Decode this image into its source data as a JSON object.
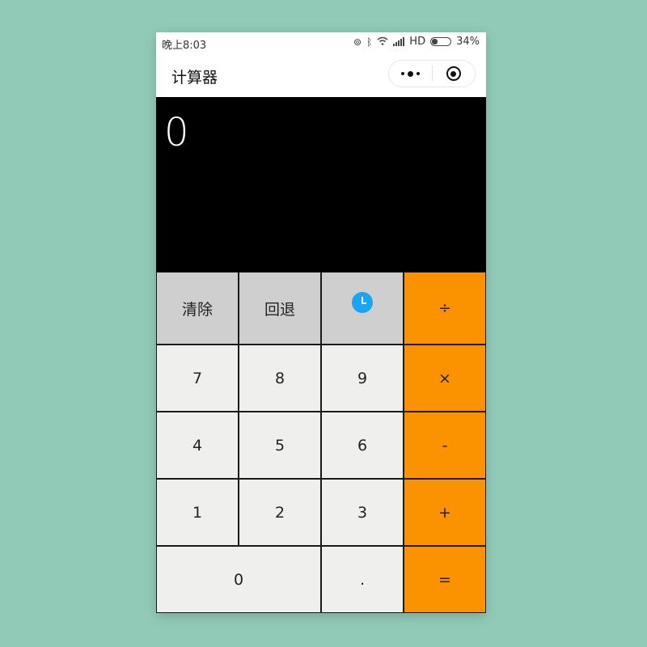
{
  "status_bar": {
    "time": "晚上8:03",
    "network": "HD",
    "battery": "34%",
    "icons": [
      "link-icon",
      "bluetooth-icon",
      "wifi-icon",
      "signal-icon",
      "battery-icon"
    ]
  },
  "nav": {
    "title": "计算器",
    "more_icon": "more-dots-icon",
    "close_icon": "target-circle-icon"
  },
  "display": {
    "value": "0"
  },
  "keys": {
    "clear": "清除",
    "backspace": "回退",
    "history_icon": "history-clock-icon",
    "divide": "÷",
    "multiply": "×",
    "minus": "-",
    "plus": "+",
    "equals": "=",
    "dot": ".",
    "digits": [
      "0",
      "1",
      "2",
      "3",
      "4",
      "5",
      "6",
      "7",
      "8",
      "9"
    ]
  },
  "colors": {
    "background": "#92cab8",
    "display_bg": "#000000",
    "function_key": "#cfcfcf",
    "number_key": "#efefed",
    "operator_key": "#fb9200",
    "history_icon": "#19a5f0"
  }
}
